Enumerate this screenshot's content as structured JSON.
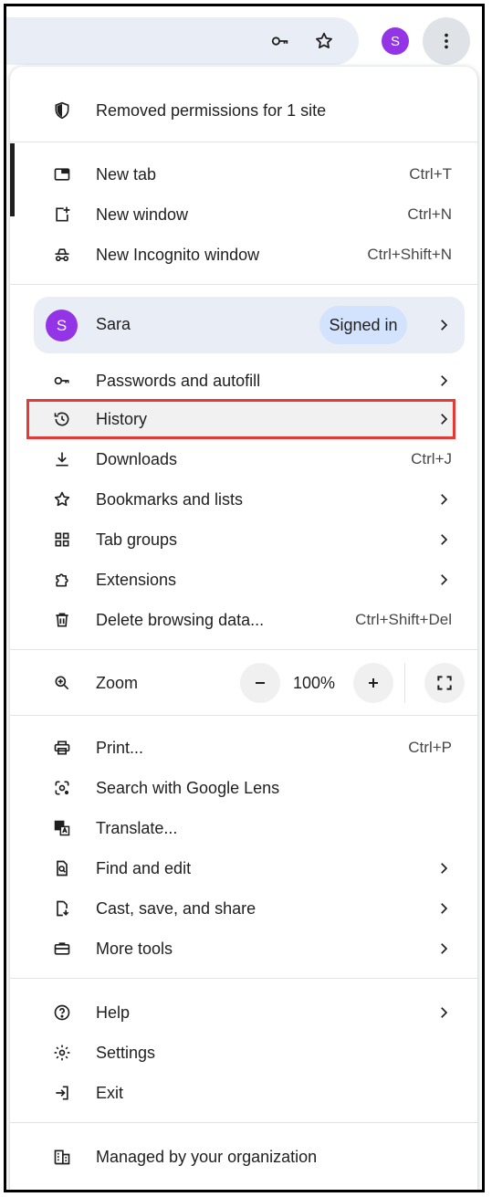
{
  "toolbar": {
    "password_key_icon": "key-icon",
    "bookmark_icon": "star-icon",
    "avatar_letter": "S",
    "menu_icon": "three-dots-vertical-icon"
  },
  "notice": {
    "label": "Removed permissions for 1 site",
    "icon": "shield-icon"
  },
  "items_group1": [
    {
      "label": "New tab",
      "shortcut": "Ctrl+T"
    },
    {
      "label": "New window",
      "shortcut": "Ctrl+N"
    },
    {
      "label": "New Incognito window",
      "shortcut": "Ctrl+Shift+N"
    }
  ],
  "profile": {
    "name": "Sara",
    "avatar_letter": "S",
    "status": "Signed in",
    "avatar_color": "#9334e6"
  },
  "items_group2": [
    {
      "label": "Passwords and autofill"
    },
    {
      "label": "History"
    },
    {
      "label": "Downloads",
      "shortcut": "Ctrl+J"
    },
    {
      "label": "Bookmarks and lists"
    },
    {
      "label": "Tab groups"
    },
    {
      "label": "Extensions"
    },
    {
      "label": "Delete browsing data...",
      "shortcut": "Ctrl+Shift+Del"
    }
  ],
  "zoom": {
    "label": "Zoom",
    "value": "100%"
  },
  "items_group3": [
    {
      "label": "Print...",
      "shortcut": "Ctrl+P"
    },
    {
      "label": "Search with Google Lens"
    },
    {
      "label": "Translate..."
    },
    {
      "label": "Find and edit"
    },
    {
      "label": "Cast, save, and share"
    },
    {
      "label": "More tools"
    }
  ],
  "items_group4": [
    {
      "label": "Help"
    },
    {
      "label": "Settings"
    },
    {
      "label": "Exit"
    }
  ],
  "footer": {
    "label": "Managed by your organization"
  },
  "colors": {
    "highlight_border": "#e53935",
    "profile_bg": "#e9eef6",
    "pill_bg": "#d3e3fd"
  }
}
